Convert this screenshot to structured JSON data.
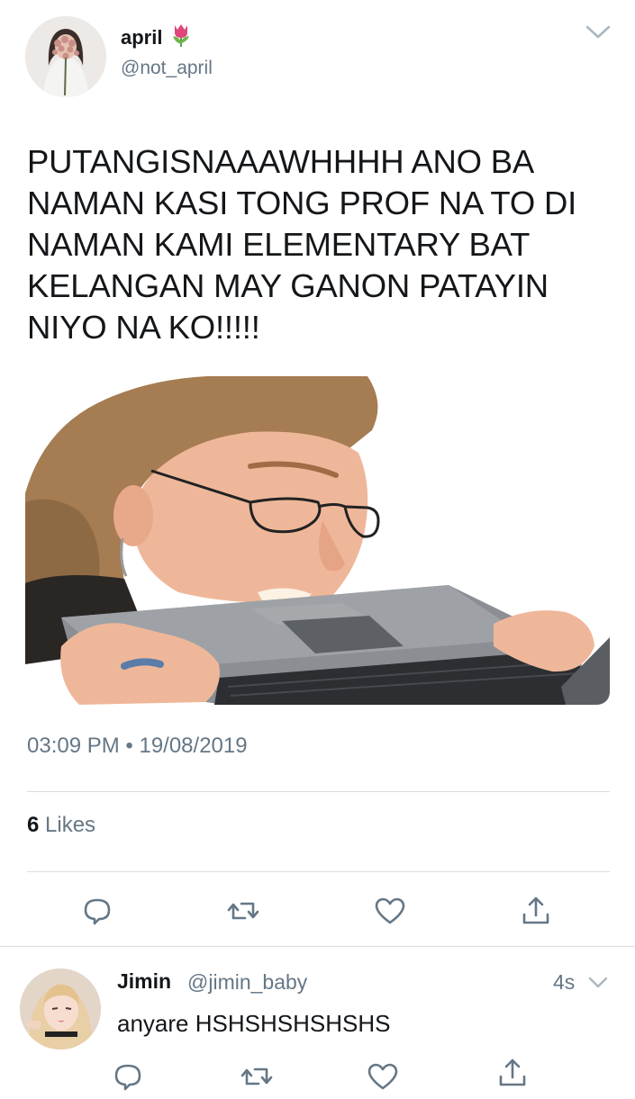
{
  "tweet": {
    "display_name": "april",
    "name_emoji": "tulip-emoji",
    "handle": "@not_april",
    "text": "PUTANGISNAAAWHHHH ANO BA\nNAMAN KASI TONG PROF NA TO DI\nNAMAN KAMI ELEMENTARY BAT\nKELANGAN MAY GANON PATAYIN\nNIYO NA KO!!!!!",
    "timestamp": "03:09 PM • 19/08/2019",
    "likes_count": "6",
    "likes_label": "Likes"
  },
  "actions": [
    "reply-icon",
    "retweet-icon",
    "like-icon",
    "share-icon"
  ],
  "reply": {
    "display_name": "Jimin",
    "handle": "@jimin_baby",
    "time": "4s",
    "text": "anyare HSHSHSHSHSHS"
  },
  "colors": {
    "text_primary": "#14171a",
    "text_secondary": "#657786",
    "divider": "#d9dee2"
  }
}
